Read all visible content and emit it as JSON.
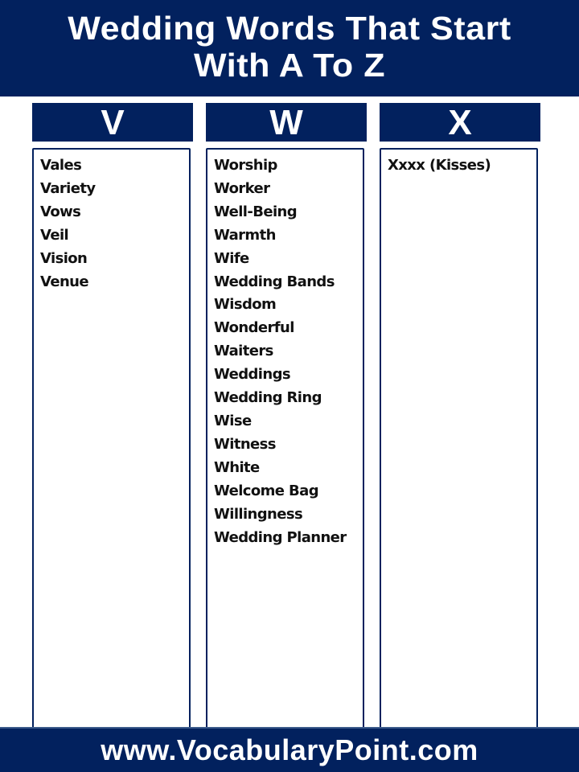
{
  "header": {
    "title_line1": "Wedding Words That Start",
    "title_line2": "With A To Z"
  },
  "columns": [
    {
      "letter": "V",
      "words": [
        "Vales",
        "Variety",
        "Vows",
        "Veil",
        "Vision",
        "Venue"
      ]
    },
    {
      "letter": "W",
      "words": [
        "Worship",
        "Worker",
        "Well-Being",
        "Warmth",
        "Wife",
        "Wedding Bands",
        "Wisdom",
        "Wonderful",
        "Waiters",
        "Weddings",
        "Wedding Ring",
        "Wise",
        "Witness",
        "White",
        "Welcome Bag",
        "Willingness",
        "Wedding Planner"
      ]
    },
    {
      "letter": "X",
      "words": [
        "Xxxx (Kisses)"
      ]
    }
  ],
  "footer": {
    "site": "www.VocabularyPoint.com"
  },
  "colors": {
    "brand_navy": "#02215e",
    "text": "#111111",
    "background": "#ffffff"
  }
}
